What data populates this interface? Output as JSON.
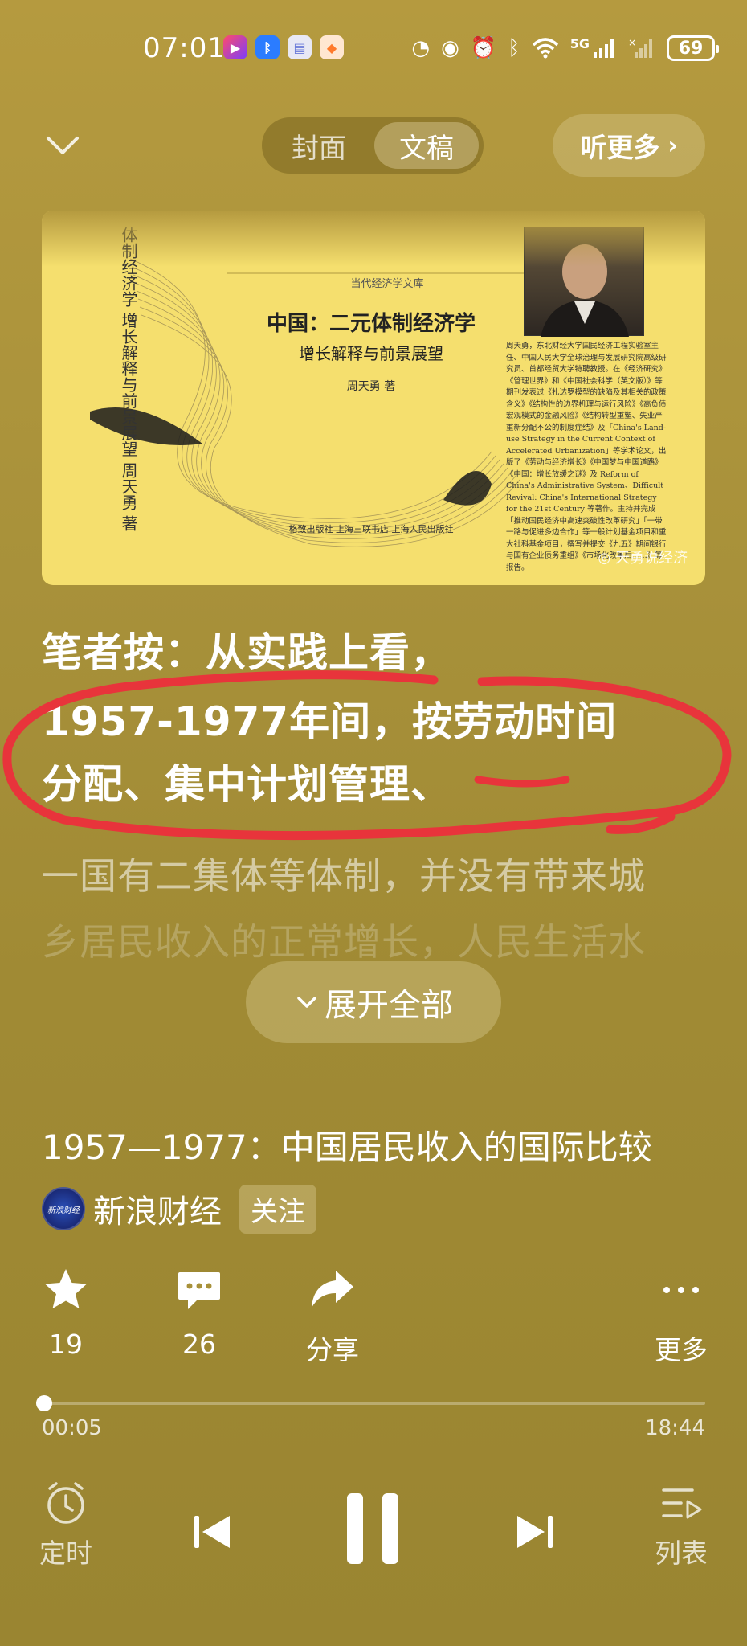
{
  "status_bar": {
    "time": "07:01",
    "network": "5G",
    "battery": "69",
    "icons": [
      "screen-record-icon",
      "bluetooth-app-icon",
      "sim-icon",
      "shield-app-icon",
      "speed-icon",
      "eye-icon",
      "alarm-icon",
      "bluetooth-icon",
      "wifi-icon",
      "signal-icon"
    ]
  },
  "header": {
    "tabs": [
      {
        "label": "封面",
        "active": false
      },
      {
        "label": "文稿",
        "active": true
      }
    ],
    "more_label": "听更多"
  },
  "cover": {
    "spine_text": "体制经济学 增长解释与前景展望 周天勇 著",
    "series": "当代经济学文库",
    "book_title": "中国：二元体制经济学",
    "book_subtitle": "增长解释与前景展望",
    "book_author": "周天勇 著",
    "publisher": "格致出版社 上海三联书店 上海人民出版社",
    "bio": "周天勇，东北财经大学国民经济工程实验室主任、中国人民大学全球治理与发展研究院高级研究员、首都经贸大学特聘教授。在《经济研究》《管理世界》和《中国社会科学（英文版）》等期刊发表过《扎达罗模型的缺陷及其相关的政策含义》《结构性的边界机理与运行风险》《高负债宏观模式的金融风险》《结构转型重塑、失业严重新分配不公的制度症结》及「China's Land-use Strategy in the Current Context of Accelerated Urbanization」等学术论文，出版了《劳动与经济增长》《中国梦与中国道路》《中国：增长放缓之谜》及 Reform of China's Administrative System、Difficult Revival: China's International Strategy for the 21st Century 等著作。主持并完成「推动国民经济中高速突破性改革研究」「一带一路与促进多边合作」等一般计划基金项目和重大社科基金项目，撰写并提交《九五》期间银行与国有企业债务重组》《市场化改革后……》等报告。",
    "watermark": "天勇说经济"
  },
  "article": {
    "lines": [
      "笔者按：从实践上看，",
      "1957-1977年间，按劳动时间",
      "分配、集中计划管理、",
      "一国有二集体等体制，并没有带来城",
      "乡居民收入的正常增长，人民生活水"
    ],
    "expand_label": "展开全部",
    "highlight_color": "#e8343b"
  },
  "episode": {
    "title": "1957—1977：中国居民收入的国际比较",
    "source_name": "新浪财经",
    "avatar_text": "新浪财经",
    "follow_label": "关注"
  },
  "actions": {
    "like_count": "19",
    "comment_count": "26",
    "share_label": "分享",
    "more_label": "更多"
  },
  "player": {
    "current_time": "00:05",
    "total_time": "18:44",
    "progress": 0.004,
    "timer_label": "定时",
    "list_label": "列表"
  }
}
